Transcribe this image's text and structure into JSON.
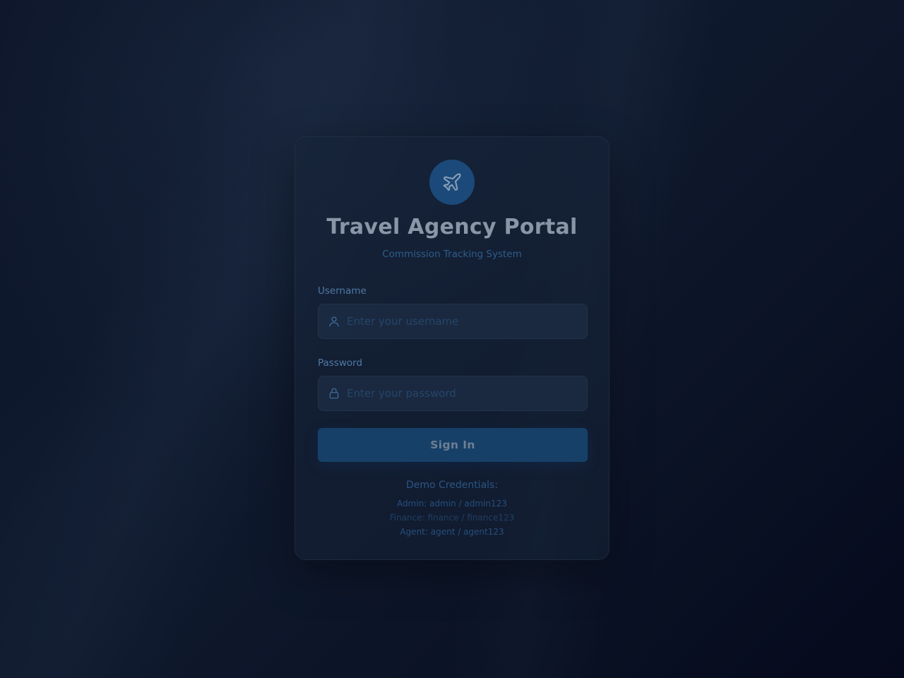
{
  "login": {
    "title": "Travel Agency Portal",
    "subtitle": "Commission Tracking System",
    "logo_icon": "airplane-icon",
    "username": {
      "label": "Username",
      "placeholder": "Enter your username",
      "value": "",
      "icon": "user-icon"
    },
    "password": {
      "label": "Password",
      "placeholder": "Enter your password",
      "value": "",
      "icon": "lock-icon"
    },
    "submit_label": "Sign In",
    "demo": {
      "title": "Demo Credentials:",
      "lines": [
        "Admin: admin / admin123",
        "Finance: finance / finance123",
        "Agent: agent / agent123"
      ]
    }
  },
  "colors": {
    "accent": "#1b4a7a",
    "button": "#174068",
    "background": "#0d1629"
  }
}
